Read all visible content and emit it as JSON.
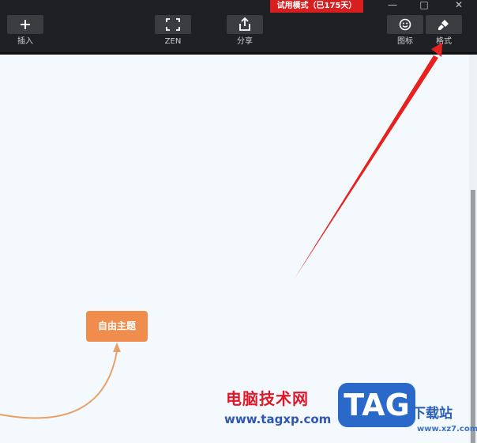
{
  "app": {
    "trial_badge": "试用模式（已175天）"
  },
  "toolbar": {
    "insert_label": "插入",
    "zen_label": "ZEN",
    "share_label": "分享",
    "icon_label": "图标",
    "format_label": "格式"
  },
  "canvas": {
    "topic_label": "自由主题"
  },
  "watermark": {
    "site_name": "电脑技术网",
    "site_url": "www.tagxp.com",
    "tag_text": "TAG",
    "xz_title": "下载站",
    "xz_url": "www.xz7.com"
  },
  "colors": {
    "toolbar_bg": "#1f2023",
    "canvas_bg": "#f3f9fc",
    "topic_fill": "#f08c4c",
    "connector": "#e9a066",
    "arrow": "#e8201e",
    "trial_badge_bg": "#d81f1f"
  },
  "icons": {
    "insert": "plus-icon",
    "zen": "fullscreen-icon",
    "share": "share-icon",
    "icon": "smiley-icon",
    "format": "brush-icon",
    "window_min": "minimize-icon",
    "window_max": "maximize-icon",
    "window_close": "close-icon"
  }
}
